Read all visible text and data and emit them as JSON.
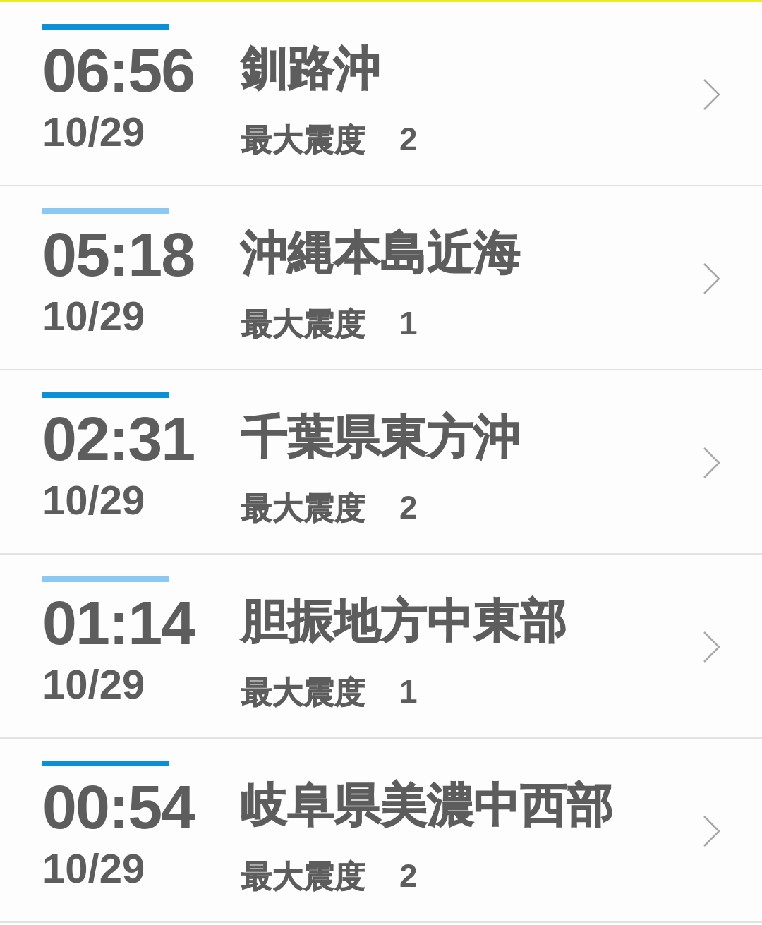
{
  "quakes": [
    {
      "time": "06:56",
      "date": "10/29",
      "place": "釧路沖",
      "intensity_label": "最大震度",
      "intensity": "2",
      "color": "#0a8fd8"
    },
    {
      "time": "05:18",
      "date": "10/29",
      "place": "沖縄本島近海",
      "intensity_label": "最大震度",
      "intensity": "1",
      "color": "#8cc8f4"
    },
    {
      "time": "02:31",
      "date": "10/29",
      "place": "千葉県東方沖",
      "intensity_label": "最大震度",
      "intensity": "2",
      "color": "#0a8fd8"
    },
    {
      "time": "01:14",
      "date": "10/29",
      "place": "胆振地方中東部",
      "intensity_label": "最大震度",
      "intensity": "1",
      "color": "#8cc8f4"
    },
    {
      "time": "00:54",
      "date": "10/29",
      "place": "岐阜県美濃中西部",
      "intensity_label": "最大震度",
      "intensity": "2",
      "color": "#0a8fd8"
    }
  ]
}
